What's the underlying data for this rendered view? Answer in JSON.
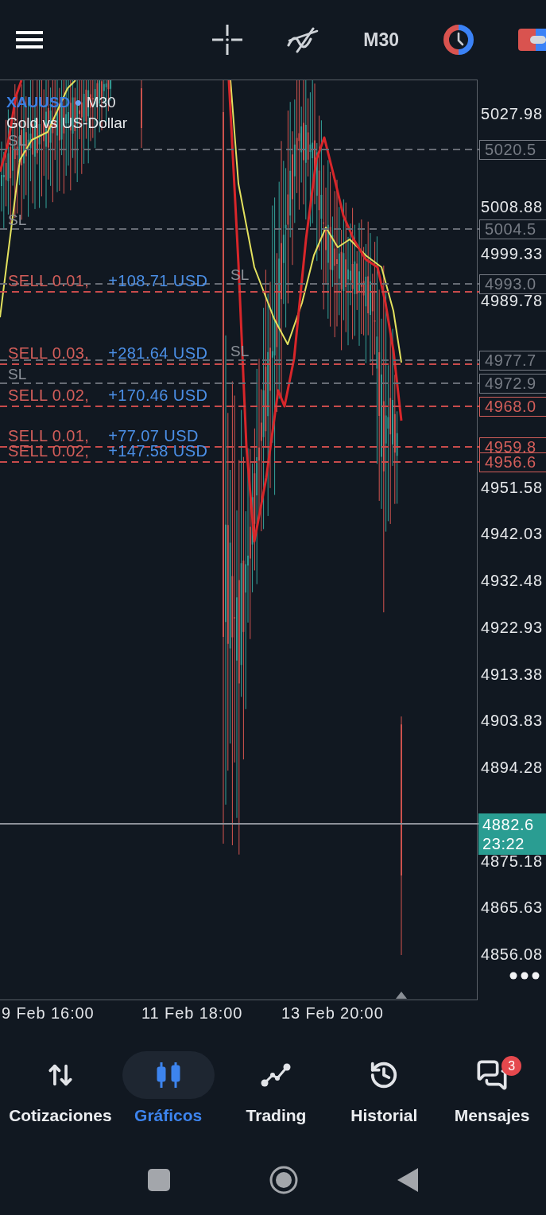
{
  "toolbar": {
    "timeframe": "M30"
  },
  "chart": {
    "symbol": "XAUUSD",
    "separator": "•",
    "timeframe": "M30",
    "description": "Gold vs US-Dollar",
    "stop_losses": [
      {
        "label": "SL",
        "price_tag": "5020.5"
      },
      {
        "label": "SL",
        "price_tag": "5004.5"
      },
      {
        "label": "SL",
        "price_tag": "4993.0"
      },
      {
        "label": "SL",
        "price_tag": "4977.7"
      },
      {
        "label": "SL",
        "price_tag": "4972.9"
      }
    ],
    "orders": [
      {
        "label": "SELL 0.01,",
        "profit": "+108.71 USD"
      },
      {
        "label": "SELL 0.03,",
        "profit": "+281.64 USD"
      },
      {
        "label": "SELL 0.02,",
        "profit": "+170.46 USD",
        "price_tag": "4968.0"
      },
      {
        "label": "SELL 0.01,",
        "profit": "+77.07 USD",
        "price_tag": "4959.8"
      },
      {
        "label": "SELL 0.02,",
        "profit": "+147.58 USD",
        "price_tag": "4956.6"
      }
    ],
    "current_price": {
      "price": "4882.6",
      "countdown": "23:22"
    },
    "price_axis": [
      "5027.98",
      "5008.88",
      "4999.33",
      "4989.78",
      "4951.58",
      "4942.03",
      "4932.48",
      "4922.93",
      "4913.38",
      "4903.83",
      "4894.28",
      "4875.18",
      "4865.63",
      "4856.08"
    ],
    "time_axis": [
      "9 Feb 16:00",
      "11 Feb 18:00",
      "13 Feb 20:00"
    ]
  },
  "nav": [
    {
      "label": "Cotizaciones",
      "selected": false
    },
    {
      "label": "Gráficos",
      "selected": true
    },
    {
      "label": "Trading",
      "selected": false
    },
    {
      "label": "Historial",
      "selected": false
    },
    {
      "label": "Mensajes",
      "selected": false,
      "badge": "3"
    }
  ]
}
